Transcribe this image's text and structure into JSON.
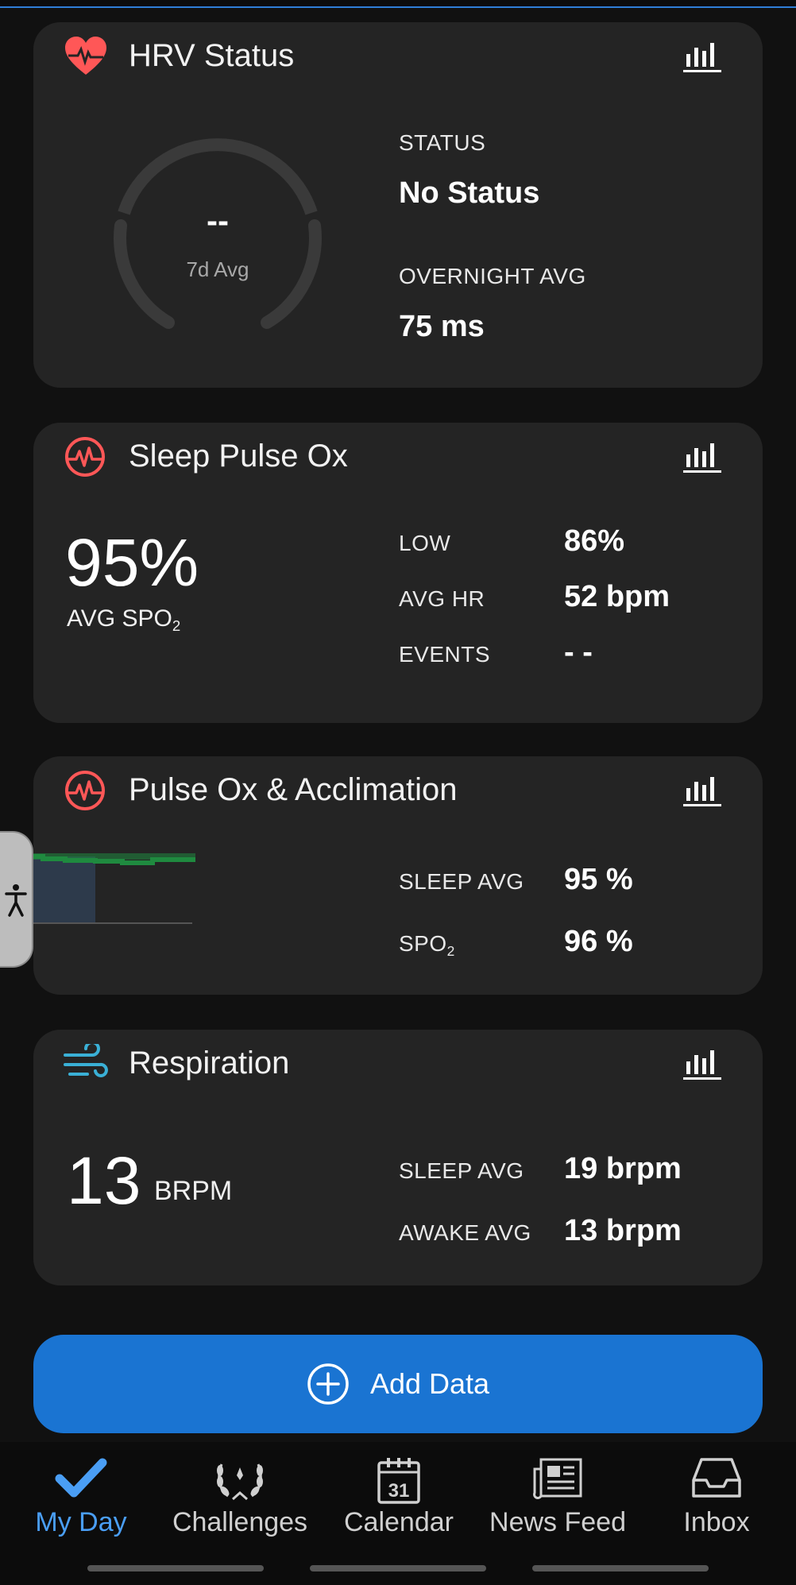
{
  "hrv": {
    "title": "HRV Status",
    "gauge_value": "--",
    "gauge_label": "7d Avg",
    "status_label": "STATUS",
    "status_value": "No Status",
    "overnight_label": "OVERNIGHT AVG",
    "overnight_value": "75 ms",
    "colors": {
      "icon": "#ff5757",
      "gauge_track": "#3a3a3a"
    }
  },
  "sleep_pulse_ox": {
    "title": "Sleep Pulse Ox",
    "big_value": "95%",
    "big_label": "AVG SPO",
    "big_label_sub": "2",
    "rows": [
      {
        "label": "LOW",
        "value": "86%"
      },
      {
        "label": "AVG HR",
        "value": "52 bpm"
      },
      {
        "label": "EVENTS",
        "value": "- -"
      }
    ]
  },
  "pulse_ox_acclimation": {
    "title": "Pulse Ox & Acclimation",
    "rows": [
      {
        "label": "SLEEP AVG",
        "label_sub": "",
        "value": "95 %"
      },
      {
        "label": "SPO",
        "label_sub": "2",
        "value": "96 %"
      }
    ],
    "colors": {
      "bar": "#2d3a4b",
      "line": "#1f8a3f"
    }
  },
  "respiration": {
    "title": "Respiration",
    "big_value": "13",
    "big_unit": "BRPM",
    "rows": [
      {
        "label": "SLEEP AVG",
        "value": "19 brpm"
      },
      {
        "label": "AWAKE AVG",
        "value": "13 brpm"
      }
    ],
    "colors": {
      "icon": "#3ab0d6"
    }
  },
  "add_data": {
    "label": "Add Data",
    "color": "#1a74d2"
  },
  "nav": {
    "items": [
      {
        "label": "My Day",
        "icon": "checkmark-icon",
        "active": true
      },
      {
        "label": "Challenges",
        "icon": "laurel-icon",
        "active": false
      },
      {
        "label": "Calendar",
        "icon": "calendar-icon",
        "calendar_day": "31",
        "active": false
      },
      {
        "label": "News Feed",
        "icon": "newspaper-icon",
        "active": false
      },
      {
        "label": "Inbox",
        "icon": "inbox-icon",
        "active": false
      }
    ],
    "active_color": "#4a9ef5"
  }
}
